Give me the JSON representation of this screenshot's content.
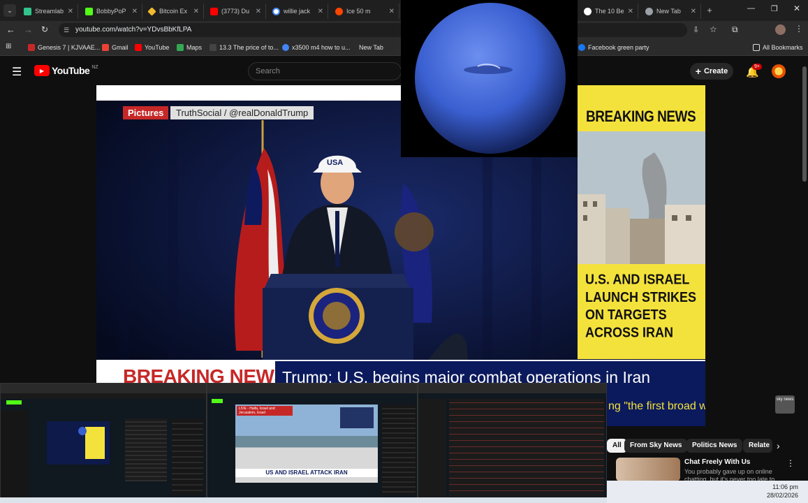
{
  "browser": {
    "tabs": [
      {
        "label": "Streamlab",
        "color": "#31c48d"
      },
      {
        "label": "BobbyPoP",
        "color": "#53fc18"
      },
      {
        "label": "Bitcoin Ex",
        "color": "#f3ba2f"
      },
      {
        "label": "(3773) Du",
        "color": "#ff0000"
      },
      {
        "label": "willie jack",
        "color": "#4285f4"
      },
      {
        "label": "Ice 50 m",
        "color": "#ff4500"
      },
      {
        "label": "The 10 Be",
        "color": "#ffffff"
      },
      {
        "label": "New Tab",
        "color": "#9aa0a6"
      }
    ],
    "url": "youtube.com/watch?v=YDvsBbKfLPA",
    "bookmarks": [
      "Genesis 7 | KJVAAE...",
      "Gmail",
      "YouTube",
      "Maps",
      "13.3 The price of to...",
      "x3500 m4 how to u...",
      "New Tab",
      "Facebook green party",
      "All Bookmarks"
    ]
  },
  "youtube": {
    "logo_text": "YouTube",
    "region": "NZ",
    "search_placeholder": "Search",
    "create_label": "Create",
    "notifications": "9+"
  },
  "video": {
    "pictures_label": "Pictures",
    "credit": "TruthSocial / @realDonaldTrump",
    "cap_text": "USA",
    "breaking_label": "BREAKING NEWS",
    "headline": "Trump: U.S. begins major combat operations in Iran",
    "subtitle": "ng \"the first broad w",
    "panel_breaking": "BREAKING NEWS",
    "panel_headline": "U.S. AND ISRAEL LAUNCH STRIKES ON TARGETS ACROSS IRAN",
    "channel_badge": "sky news"
  },
  "mini_screens": {
    "center_live": "LIVE - Haifa, Israel and Jerusalem, Israel",
    "center_banner": "US AND ISRAEL ATTACK IRAN"
  },
  "related": {
    "chips": [
      "All",
      "From Sky News",
      "Politics News",
      "Relate"
    ],
    "item_title": "Chat Freely With Us",
    "item_text": "You probably gave up on online chatting, but it's never too late to try"
  },
  "taskbar": {
    "time": "11:06 pm",
    "date": "28/02/2026"
  },
  "colors": {
    "youtube_red": "#ff0000",
    "sky_yellow": "#f4e23c",
    "sky_blue": "#0b1a5c",
    "neptune": "#3a5fd0"
  }
}
